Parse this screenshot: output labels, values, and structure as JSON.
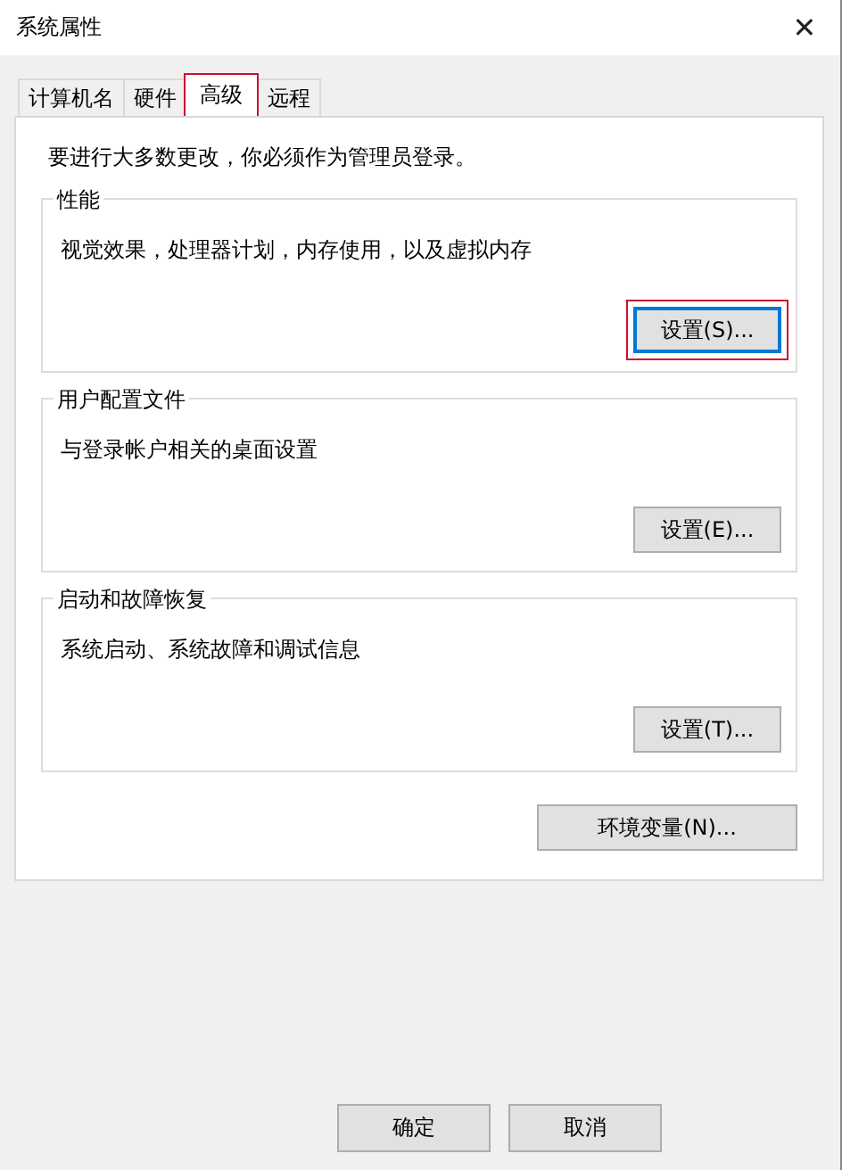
{
  "window": {
    "title": "系统属性",
    "close": "✕"
  },
  "tabs": [
    {
      "label": "计算机名",
      "selected": false,
      "highlighted": false
    },
    {
      "label": "硬件",
      "selected": false,
      "highlighted": false
    },
    {
      "label": "高级",
      "selected": true,
      "highlighted": true
    },
    {
      "label": "远程",
      "selected": false,
      "highlighted": false
    }
  ],
  "notice": "要进行大多数更改，你必须作为管理员登录。",
  "groups": [
    {
      "title": "性能",
      "description": "视觉效果，处理器计划，内存使用，以及虚拟内存",
      "button": {
        "label": "设置(S)...",
        "focused": true,
        "highlighted": true
      }
    },
    {
      "title": "用户配置文件",
      "description": "与登录帐户相关的桌面设置",
      "button": {
        "label": "设置(E)...",
        "focused": false,
        "highlighted": false
      }
    },
    {
      "title": "启动和故障恢复",
      "description": "系统启动、系统故障和调试信息",
      "button": {
        "label": "设置(T)...",
        "focused": false,
        "highlighted": false
      }
    }
  ],
  "env_button": "环境变量(N)...",
  "footer_buttons": [
    "确定",
    "取消"
  ]
}
